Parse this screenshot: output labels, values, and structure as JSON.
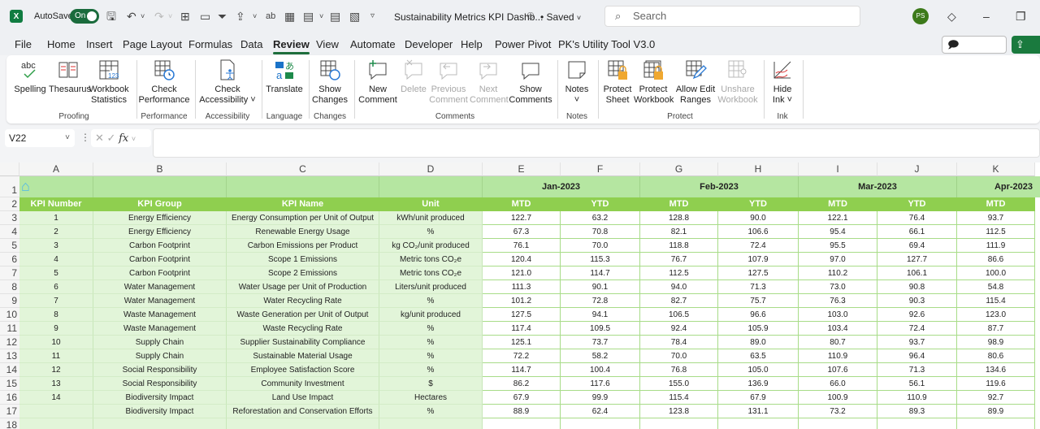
{
  "titlebar": {
    "app_icon": "excel-icon",
    "autosave_label": "AutoSave",
    "autosave_state": "On",
    "document_title": "Sustainability Metrics KPI Dashb...",
    "saved_status": "• Saved",
    "search_placeholder": "Search",
    "user_initials": "PS"
  },
  "menu": {
    "tabs": [
      "File",
      "Home",
      "Insert",
      "Page Layout",
      "Formulas",
      "Data",
      "Review",
      "View",
      "Automate",
      "Developer",
      "Help",
      "Power Pivot",
      "PK's Utility Tool V3.0"
    ],
    "active_tab": "Review",
    "comments_label": "Comments",
    "share_label": "Share"
  },
  "ribbon": {
    "buttons": [
      {
        "label1": "Spelling",
        "label2": "",
        "icon": "spelling-icon",
        "enabled": true
      },
      {
        "label1": "Thesaurus",
        "label2": "",
        "icon": "thesaurus-icon",
        "enabled": true
      },
      {
        "label1": "Workbook",
        "label2": "Statistics",
        "icon": "workbook-statistics-icon",
        "enabled": true
      },
      {
        "label1": "Check",
        "label2": "Performance",
        "icon": "check-performance-icon",
        "enabled": true
      },
      {
        "label1": "Check",
        "label2": "Accessibility ˅",
        "icon": "check-accessibility-icon",
        "enabled": true
      },
      {
        "label1": "Translate",
        "label2": "",
        "icon": "translate-icon",
        "enabled": true
      },
      {
        "label1": "Show",
        "label2": "Changes",
        "icon": "show-changes-icon",
        "enabled": true
      },
      {
        "label1": "New",
        "label2": "Comment",
        "icon": "new-comment-icon",
        "enabled": true
      },
      {
        "label1": "Delete",
        "label2": "",
        "icon": "delete-comment-icon",
        "enabled": false
      },
      {
        "label1": "Previous",
        "label2": "Comment",
        "icon": "previous-comment-icon",
        "enabled": false
      },
      {
        "label1": "Next",
        "label2": "Comment",
        "icon": "next-comment-icon",
        "enabled": false
      },
      {
        "label1": "Show",
        "label2": "Comments",
        "icon": "show-comments-icon",
        "enabled": true
      },
      {
        "label1": "Notes",
        "label2": "˅",
        "icon": "notes-icon",
        "enabled": true
      },
      {
        "label1": "Protect",
        "label2": "Sheet",
        "icon": "protect-sheet-icon",
        "enabled": true
      },
      {
        "label1": "Protect",
        "label2": "Workbook",
        "icon": "protect-workbook-icon",
        "enabled": true
      },
      {
        "label1": "Allow Edit",
        "label2": "Ranges",
        "icon": "allow-edit-ranges-icon",
        "enabled": true
      },
      {
        "label1": "Unshare",
        "label2": "Workbook",
        "icon": "unshare-workbook-icon",
        "enabled": false
      },
      {
        "label1": "Hide",
        "label2": "Ink ˅",
        "icon": "hide-ink-icon",
        "enabled": true
      }
    ],
    "groups": [
      "Proofing",
      "Performance",
      "Accessibility",
      "Language",
      "Changes",
      "Comments",
      "Notes",
      "Protect",
      "Ink"
    ]
  },
  "formula_bar": {
    "name_box": "V22",
    "formula": ""
  },
  "sheet": {
    "column_letters": [
      "A",
      "B",
      "C",
      "D",
      "E",
      "F",
      "G",
      "H",
      "I",
      "J",
      "K"
    ],
    "row_numbers": [
      "1",
      "2",
      "3",
      "4",
      "5",
      "6",
      "7",
      "8",
      "9",
      "10",
      "11",
      "12",
      "13",
      "14",
      "15",
      "16",
      "17",
      "18"
    ],
    "months": [
      "Jan-2023",
      "Feb-2023",
      "Mar-2023",
      "Apr-2023"
    ],
    "headers": [
      "KPI Number",
      "KPI Group",
      "KPI Name",
      "Unit"
    ],
    "sub_headers": [
      "MTD",
      "YTD",
      "MTD",
      "YTD",
      "MTD",
      "YTD",
      "MTD"
    ],
    "rows": [
      {
        "num": "1",
        "group": "Energy Efficiency",
        "name": "Energy Consumption per Unit of Output",
        "unit": "kWh/unit produced",
        "values": [
          "122.7",
          "63.2",
          "128.8",
          "90.0",
          "122.1",
          "76.4",
          "93.7"
        ]
      },
      {
        "num": "2",
        "group": "Energy Efficiency",
        "name": "Renewable Energy Usage",
        "unit": "%",
        "values": [
          "67.3",
          "70.8",
          "82.1",
          "106.6",
          "95.4",
          "66.1",
          "112.5"
        ]
      },
      {
        "num": "3",
        "group": "Carbon Footprint",
        "name": "Carbon Emissions per Product",
        "unit": "kg CO₂/unit produced",
        "values": [
          "76.1",
          "70.0",
          "118.8",
          "72.4",
          "95.5",
          "69.4",
          "111.9"
        ]
      },
      {
        "num": "4",
        "group": "Carbon Footprint",
        "name": "Scope 1 Emissions",
        "unit": "Metric tons CO₂e",
        "values": [
          "120.4",
          "115.3",
          "76.7",
          "107.9",
          "97.0",
          "127.7",
          "86.6"
        ]
      },
      {
        "num": "5",
        "group": "Carbon Footprint",
        "name": "Scope 2 Emissions",
        "unit": "Metric tons CO₂e",
        "values": [
          "121.0",
          "114.7",
          "112.5",
          "127.5",
          "110.2",
          "106.1",
          "100.0"
        ]
      },
      {
        "num": "6",
        "group": "Water Management",
        "name": "Water Usage per Unit of Production",
        "unit": "Liters/unit produced",
        "values": [
          "111.3",
          "90.1",
          "94.0",
          "71.3",
          "73.0",
          "90.8",
          "54.8"
        ]
      },
      {
        "num": "7",
        "group": "Water Management",
        "name": "Water Recycling Rate",
        "unit": "%",
        "values": [
          "101.2",
          "72.8",
          "82.7",
          "75.7",
          "76.3",
          "90.3",
          "115.4"
        ]
      },
      {
        "num": "8",
        "group": "Waste Management",
        "name": "Waste Generation per Unit of Output",
        "unit": "kg/unit produced",
        "values": [
          "127.5",
          "94.1",
          "106.5",
          "96.6",
          "103.0",
          "92.6",
          "123.0"
        ]
      },
      {
        "num": "9",
        "group": "Waste Management",
        "name": "Waste Recycling Rate",
        "unit": "%",
        "values": [
          "117.4",
          "109.5",
          "92.4",
          "105.9",
          "103.4",
          "72.4",
          "87.7"
        ]
      },
      {
        "num": "10",
        "group": "Supply Chain",
        "name": "Supplier Sustainability Compliance",
        "unit": "%",
        "values": [
          "125.1",
          "73.7",
          "78.4",
          "89.0",
          "80.7",
          "93.7",
          "98.9"
        ]
      },
      {
        "num": "11",
        "group": "Supply Chain",
        "name": "Sustainable Material Usage",
        "unit": "%",
        "values": [
          "72.2",
          "58.2",
          "70.0",
          "63.5",
          "110.9",
          "96.4",
          "80.6"
        ]
      },
      {
        "num": "12",
        "group": "Social Responsibility",
        "name": "Employee Satisfaction Score",
        "unit": "%",
        "values": [
          "114.7",
          "100.4",
          "76.8",
          "105.0",
          "107.6",
          "71.3",
          "134.6"
        ]
      },
      {
        "num": "13",
        "group": "Social Responsibility",
        "name": "Community Investment",
        "unit": "$",
        "values": [
          "86.2",
          "117.6",
          "155.0",
          "136.9",
          "66.0",
          "56.1",
          "119.6"
        ]
      },
      {
        "num": "14",
        "group": "Biodiversity Impact",
        "name": "Land Use Impact",
        "unit": "Hectares",
        "values": [
          "67.9",
          "99.9",
          "115.4",
          "67.9",
          "100.9",
          "110.9",
          "92.7"
        ]
      },
      {
        "num": "",
        "group": "Biodiversity Impact",
        "name": "Reforestation and Conservation Efforts",
        "unit": "%",
        "values": [
          "88.9",
          "62.4",
          "123.8",
          "131.1",
          "73.2",
          "89.3",
          "89.9"
        ]
      }
    ]
  }
}
